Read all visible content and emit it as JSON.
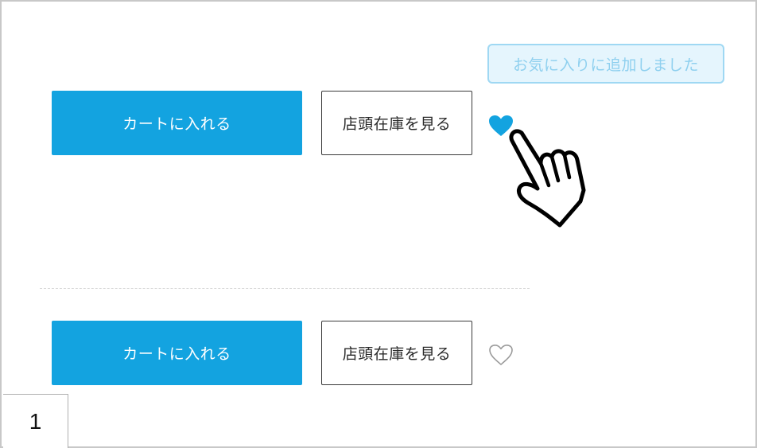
{
  "product_rows": [
    {
      "cart_button_label": "カートに入れる",
      "store_stock_button_label": "店頭在庫を見る",
      "favorite_state": "filled"
    },
    {
      "cart_button_label": "カートに入れる",
      "store_stock_button_label": "店頭在庫を見る",
      "favorite_state": "outline"
    }
  ],
  "toast": {
    "message": "お気に入りに追加しました"
  },
  "step_badge": {
    "number": "1"
  },
  "icons": {
    "favorite_filled": "heart-filled-icon",
    "favorite_outline": "heart-outline-icon",
    "pointer": "pointing-hand-icon"
  },
  "colors": {
    "primary": "#13a3e0",
    "toast_border": "#9fd8f3",
    "toast_bg": "#e5f5fd",
    "toast_text": "#8fd0ef",
    "heart_outline": "#9a9a9a"
  }
}
